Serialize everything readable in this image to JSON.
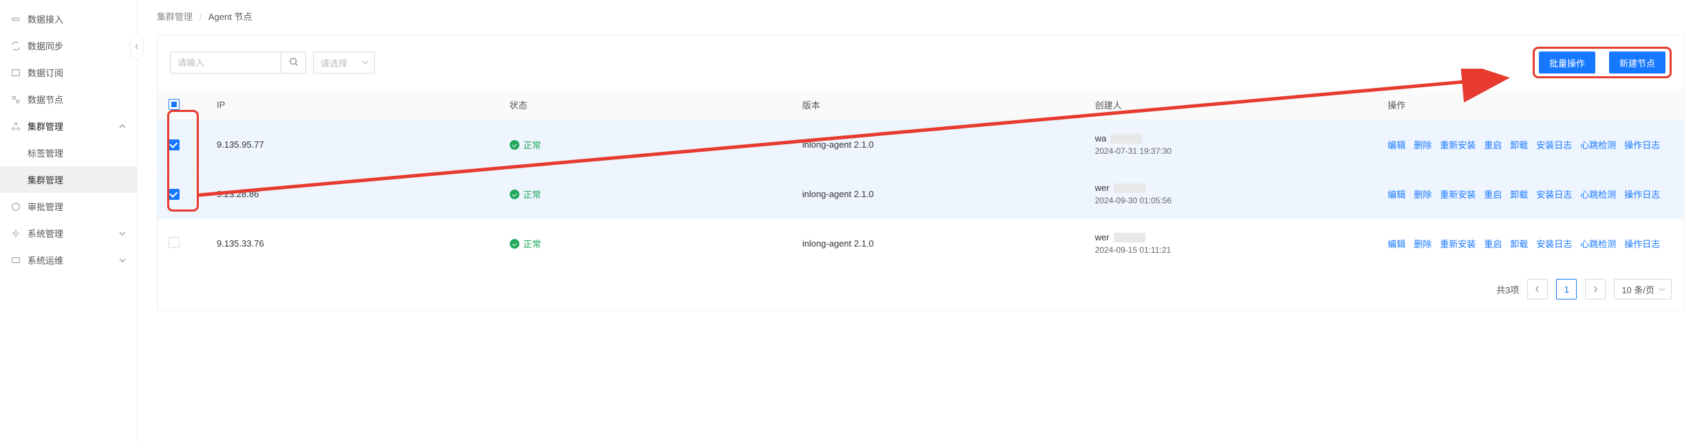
{
  "sidebar": {
    "items": [
      {
        "label": "数据接入",
        "icon": "link-icon"
      },
      {
        "label": "数据同步",
        "icon": "sync-icon"
      },
      {
        "label": "数据订阅",
        "icon": "sub-icon"
      },
      {
        "label": "数据节点",
        "icon": "node-icon"
      },
      {
        "label": "集群管理",
        "icon": "cluster-icon",
        "expanded": true,
        "children": [
          {
            "label": "标签管理"
          },
          {
            "label": "集群管理",
            "active": true
          }
        ]
      },
      {
        "label": "审批管理",
        "icon": "approve-icon"
      },
      {
        "label": "系统管理",
        "icon": "gear-icon",
        "expandable": true
      },
      {
        "label": "系统运维",
        "icon": "ops-icon",
        "expandable": true
      }
    ]
  },
  "breadcrumb": {
    "parent": "集群管理",
    "current": "Agent 节点"
  },
  "toolbar": {
    "search_placeholder": "请输入",
    "select_placeholder": "请选择",
    "batch_label": "批量操作",
    "create_label": "新建节点"
  },
  "table": {
    "headers": {
      "ip": "IP",
      "status": "状态",
      "version": "版本",
      "creator": "创建人",
      "ops": "操作"
    },
    "status_normal": "正常",
    "action_labels": {
      "edit": "编辑",
      "delete": "删除",
      "reinstall": "重新安装",
      "restart": "重启",
      "uninstall": "卸载",
      "install_log": "安装日志",
      "heartbeat": "心跳检测",
      "op_log": "操作日志"
    },
    "rows": [
      {
        "checked": true,
        "ip": "9.135.95.77",
        "version": "inlong-agent 2.1.0",
        "creator": "wa",
        "time": "2024-07-31 19:37:30"
      },
      {
        "checked": true,
        "ip": "9.23.28.86",
        "version": "inlong-agent 2.1.0",
        "creator": "wer",
        "time": "2024-09-30 01:05:56"
      },
      {
        "checked": false,
        "ip": "9.135.33.76",
        "version": "inlong-agent 2.1.0",
        "creator": "wer",
        "time": "2024-09-15 01:11:21"
      }
    ]
  },
  "pagination": {
    "total_label": "共3项",
    "page": "1",
    "size_label": "10 条/页"
  },
  "colors": {
    "primary": "#1677ff",
    "success": "#22a75d",
    "anno": "#e63b2e"
  }
}
